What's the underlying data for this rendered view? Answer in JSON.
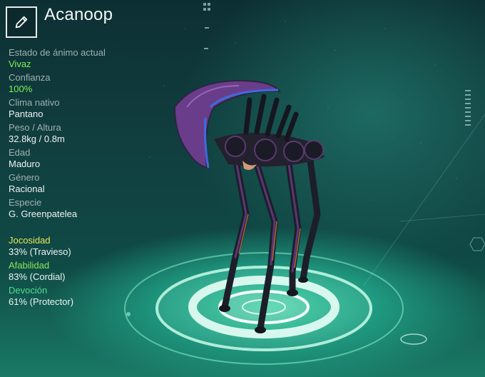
{
  "creature": {
    "name": "Acanoop"
  },
  "stats": [
    {
      "label": "Estado de ánimo actual",
      "value": "Vivaz",
      "highlight": true
    },
    {
      "label": "Confianza",
      "value": "100%",
      "highlight": true
    },
    {
      "label": "Clima nativo",
      "value": "Pantano"
    },
    {
      "label": "Peso / Altura",
      "value": "32.8kg / 0.8m"
    },
    {
      "label": "Edad",
      "value": "Maduro"
    },
    {
      "label": "Género",
      "value": "Racional"
    },
    {
      "label": "Especie",
      "value": "G. Greenpatelea"
    }
  ],
  "traits": [
    {
      "label": "Jocosidad",
      "value": "33% (Travieso)",
      "color": "#e6e55a"
    },
    {
      "label": "Afabilidad",
      "value": "83% (Cordial)",
      "color": "#8ee657"
    },
    {
      "label": "Devoción",
      "value": "61% (Protector)",
      "color": "#4ede8a"
    }
  ],
  "icons": {
    "edit": "pencil-icon"
  }
}
